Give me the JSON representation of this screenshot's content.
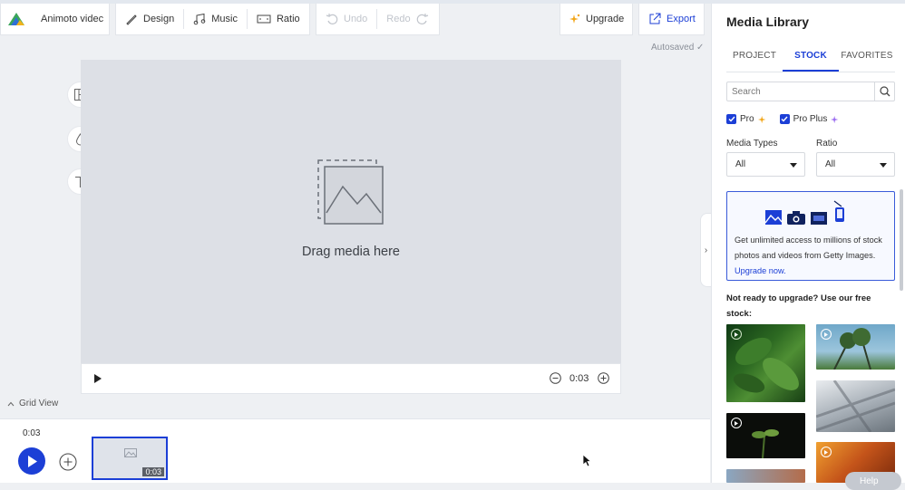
{
  "toolbar": {
    "project_name": "Animoto videc",
    "design": "Design",
    "music": "Music",
    "ratio": "Ratio",
    "undo": "Undo",
    "redo": "Redo",
    "upgrade": "Upgrade",
    "export": "Export",
    "autosaved": "Autosaved"
  },
  "canvas": {
    "drag_text": "Drag media here",
    "duration": "0:03"
  },
  "grid_view": "Grid View",
  "timeline": {
    "current_time": "0:03",
    "clip_duration": "0:03"
  },
  "panel": {
    "title": "Media Library",
    "tabs": [
      {
        "label": "PROJECT"
      },
      {
        "label": "STOCK"
      },
      {
        "label": "FAVORITES"
      }
    ],
    "active_tab": "STOCK",
    "search_placeholder": "Search",
    "filters": {
      "pro_label": "Pro",
      "pro_checked": true,
      "pro_plus_label": "Pro Plus",
      "pro_plus_checked": true
    },
    "media_types_label": "Media Types",
    "media_types_value": "All",
    "ratio_label": "Ratio",
    "ratio_value": "All",
    "promo_text": "Get unlimited access to millions of stock photos and videos from Getty Images.",
    "promo_link": "Upgrade now.",
    "not_ready": "Not ready to upgrade? Use our free stock:",
    "help": "Help"
  },
  "colors": {
    "accent": "#1c3fd6",
    "canvas_bg": "#dde0e6",
    "upgrade_star": "#f2a516"
  }
}
